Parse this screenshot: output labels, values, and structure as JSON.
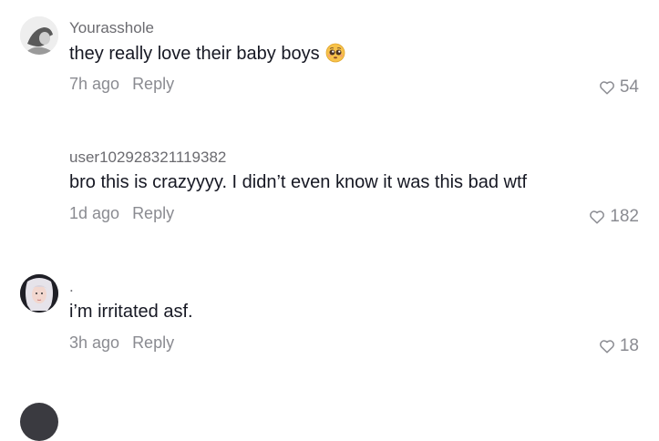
{
  "comments": [
    {
      "username": "Yourasshole",
      "text": "they really love their baby boys",
      "emoji": "pleading-face-emoji",
      "time": "7h ago",
      "reply": "Reply",
      "likes": "54",
      "has_avatar": true
    },
    {
      "username": "user102928321119382",
      "text": "bro this is crazyyyy. I didn’t even know it was this bad wtf",
      "time": "1d ago",
      "reply": "Reply",
      "likes": "182",
      "has_avatar": false
    },
    {
      "username": ".",
      "text": "i’m irritated asf.",
      "time": "3h ago",
      "reply": "Reply",
      "likes": "18",
      "has_avatar": true
    }
  ],
  "icons": {
    "like": "heart-outline-icon"
  },
  "colors": {
    "text": "#161823",
    "muted": "#8a8b91",
    "username": "#6b6b70"
  }
}
